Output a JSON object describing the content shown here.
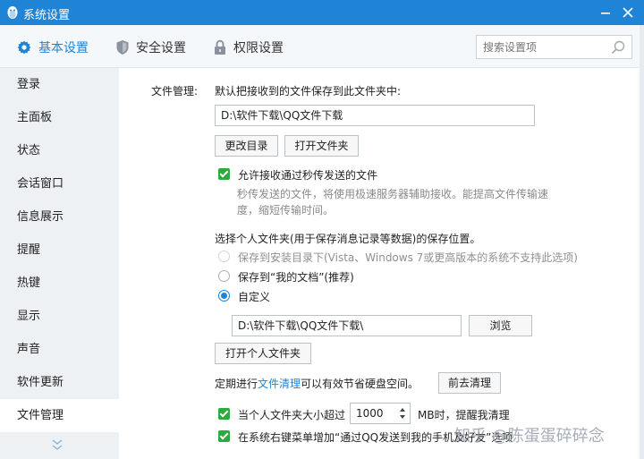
{
  "window": {
    "title": "系统设置"
  },
  "tabs": [
    {
      "label": "基本设置",
      "icon": "gear-icon"
    },
    {
      "label": "安全设置",
      "icon": "shield-icon"
    },
    {
      "label": "权限设置",
      "icon": "lock-icon"
    }
  ],
  "search": {
    "placeholder": "搜索设置项"
  },
  "sidebar": {
    "items": [
      {
        "label": "登录"
      },
      {
        "label": "主面板"
      },
      {
        "label": "状态"
      },
      {
        "label": "会话窗口"
      },
      {
        "label": "信息展示"
      },
      {
        "label": "提醒"
      },
      {
        "label": "热键"
      },
      {
        "label": "显示"
      },
      {
        "label": "声音"
      },
      {
        "label": "软件更新"
      },
      {
        "label": "文件管理"
      }
    ],
    "active_index": 10
  },
  "file_mgmt": {
    "section_label": "文件管理:",
    "default_folder_label": "默认把接收到的文件保存到此文件夹中:",
    "default_path": "D:\\软件下载\\QQ文件下载",
    "change_dir_btn": "更改目录",
    "open_folder_btn": "打开文件夹",
    "instant_transfer": {
      "label": "允许接收通过秒传发送的文件",
      "desc_line1": "秒传发送的文件，将使用极速服务器辅助接收。能提高文件传输速",
      "desc_line2": "度，缩短传输时间。",
      "checked": true
    },
    "personal_folder_label": "选择个人文件夹(用于保存消息记录等数据)的保存位置。",
    "radio_options": [
      {
        "label": "保存到安装目录下(Vista、Windows 7或更高版本的系统不支持此选项)",
        "state": "disabled"
      },
      {
        "label": "保存到“我的文档”(推荐)",
        "state": "unselected"
      },
      {
        "label": "自定义",
        "state": "selected"
      }
    ],
    "custom_path": "D:\\软件下载\\QQ文件下载\\",
    "browse_btn": "浏览",
    "open_personal_btn": "打开个人文件夹",
    "cleanup_prefix": "定期进行",
    "cleanup_link": "文件清理",
    "cleanup_suffix": "可以有效节省硬盘空间。",
    "cleanup_btn": "前去清理",
    "size_alert_prefix": "当个人文件夹大小超过",
    "size_alert_value": "1000",
    "size_alert_suffix": "MB时，提醒我清理",
    "context_menu_label": "在系统右键菜单增加“通过QQ发送到我的手机及好友”选项"
  },
  "watermark": "知乎 @陈蛋蛋碎碎念",
  "colors": {
    "accent": "#1f83d6",
    "checkbox": "#2bab3e",
    "sidebar_bg": "#eef1f4"
  }
}
